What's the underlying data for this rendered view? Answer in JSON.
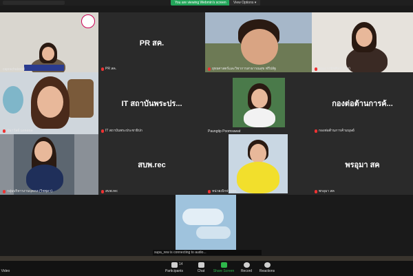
{
  "topbar": {
    "share_banner": "You are viewing Webmin's screen",
    "view_options": "View Options ▾"
  },
  "tiles": [
    {
      "label": "caprachabood",
      "text": ""
    },
    {
      "label": "PR สค.",
      "text": "PR สค."
    },
    {
      "label": "ยุทธศาสตร์และวิชาการสาธารณสุข ฟรีปลัฐ",
      "text": ""
    },
    {
      "label": "ขนม วานิชศิลป์ (Pro)",
      "text": ""
    },
    {
      "label": "ปนาวัลย์ มงคลผล",
      "text": ""
    },
    {
      "label": "IT สถาบันพระประชาธิปก",
      "text": "IT สถาบันพระปร..."
    },
    {
      "label": "Paungtip Poomsawat",
      "text": ""
    },
    {
      "label": "กองต่อต้านการค้ามนุษย์",
      "text": "กองต่อต้านการค้..."
    },
    {
      "label": "กลุ่มบริหารงานบุคคล (วิชชุดา)",
      "text": ""
    },
    {
      "label": "สบพ.rec",
      "text": "สบพ.rec"
    },
    {
      "label": "หน่วยเบิกจ่ายสค.",
      "text": ""
    },
    {
      "label": "พรอุมา สค",
      "text": "พรอุมา   สค"
    },
    {
      "label": "supa_rew",
      "text": ""
    }
  ],
  "connecting_text": "supa_rew is connecting to audio...",
  "controls": {
    "participants_label": "Participants",
    "participants_count": "14",
    "chat_label": "Chat",
    "share_label": "Share Screen",
    "record_label": "Record",
    "reactions_label": "Reactions",
    "left_label": "Video"
  },
  "colors": {
    "share_green": "#23a55a",
    "mic_muted": "#ee3333",
    "tile_bg": "#2a2a2a"
  }
}
